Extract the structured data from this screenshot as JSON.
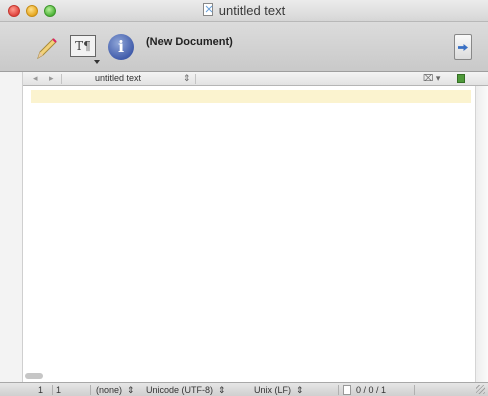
{
  "window": {
    "title": "untitled text",
    "traffic_lights": [
      "close",
      "minimize",
      "maximize"
    ]
  },
  "toolbar": {
    "document_name": "(New Document)",
    "text_options_glyph": "T¶",
    "info_glyph": "i",
    "icons": [
      "pencil-icon",
      "text-options-icon",
      "info-icon",
      "sidebar-toggle-icon"
    ]
  },
  "navbar": {
    "back_glyph": "◂",
    "forward_glyph": "▸",
    "file_name": "untitled text",
    "updown_glyph": "⇕",
    "symbols_glyph": "⌧ ▾"
  },
  "editor": {
    "content": "",
    "current_line_highlight": "#fbf3cf"
  },
  "statusbar": {
    "line": "1",
    "column": "1",
    "language": "(none)",
    "encoding": "Unicode (UTF-8)",
    "line_endings": "Unix (LF)",
    "selector_glyph": "⇕",
    "counts": "0 / 0 / 1"
  },
  "colors": {
    "close": "#e0443e",
    "minimize": "#e6a822",
    "maximize": "#4fb43a",
    "info_icon": "#3d58a8",
    "sidebar_arrow": "#3a70c4"
  }
}
